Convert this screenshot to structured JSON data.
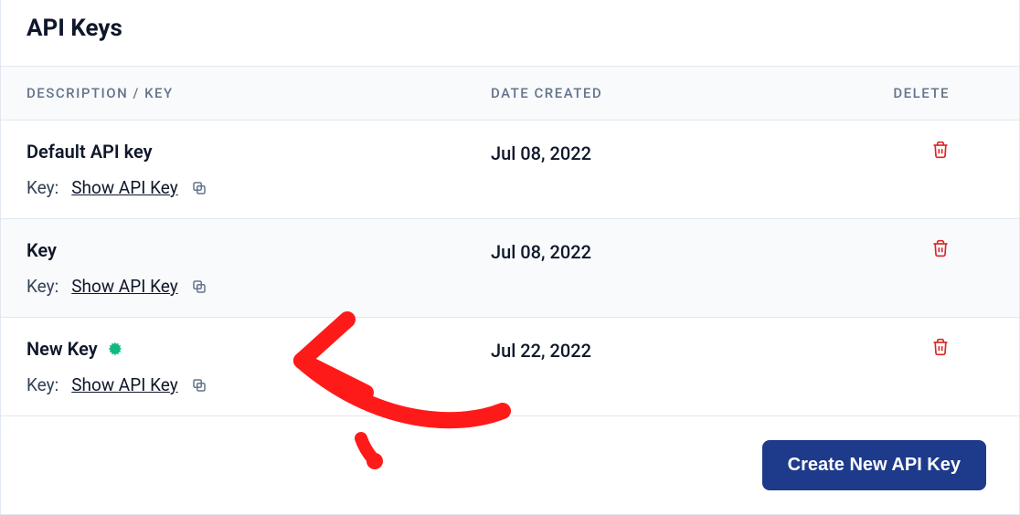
{
  "page_title": "API Keys",
  "table": {
    "headers": {
      "description": "DESCRIPTION / KEY",
      "date": "DATE CREATED",
      "delete": "DELETE"
    },
    "rows": [
      {
        "name": "Default API key",
        "date": "Jul 08, 2022",
        "new": false
      },
      {
        "name": "Key",
        "date": "Jul 08, 2022",
        "new": false
      },
      {
        "name": "New Key",
        "date": "Jul 22, 2022",
        "new": true
      }
    ],
    "key_prefix": "Key:",
    "show_label": "Show API Key"
  },
  "create_button": "Create New API Key",
  "colors": {
    "accent": "#1e3a8a",
    "danger": "#dc2626",
    "new_badge": "#10b981"
  }
}
